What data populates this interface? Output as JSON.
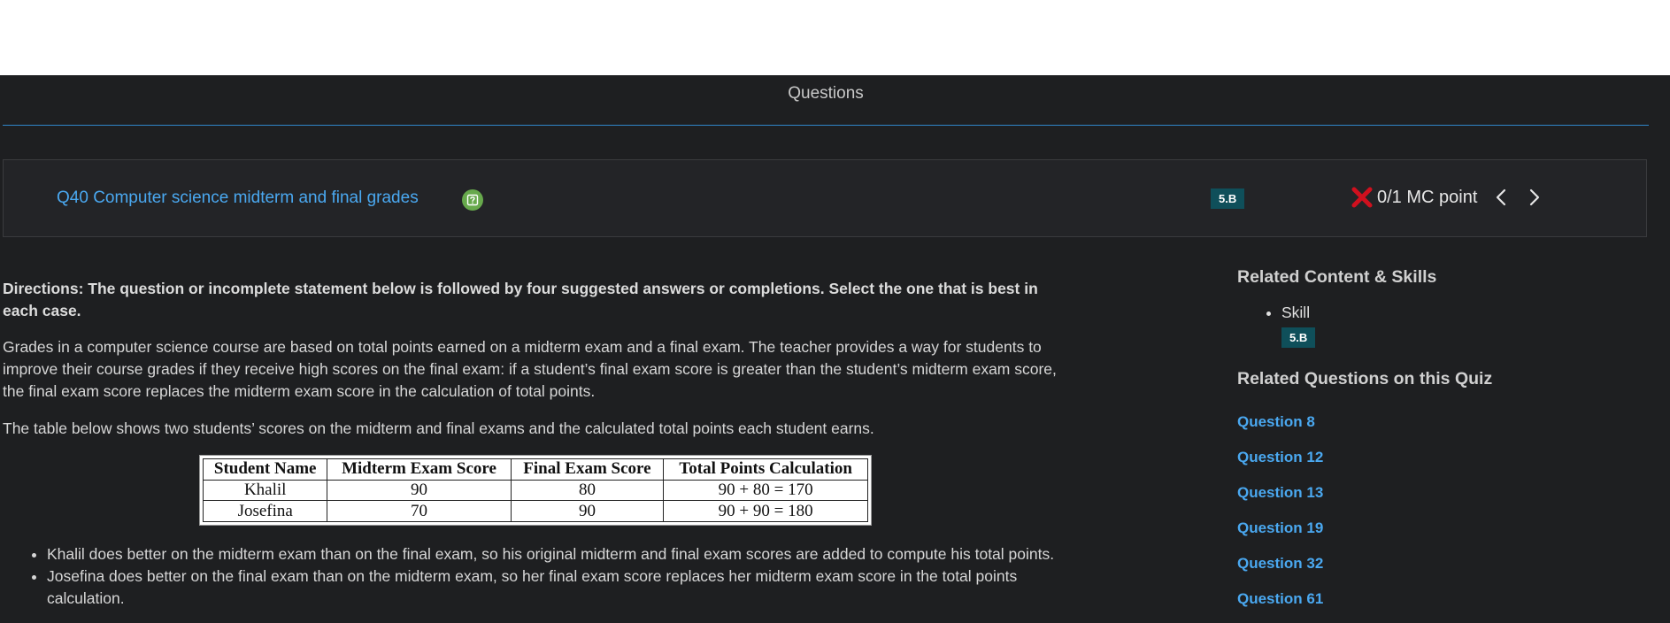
{
  "page": {
    "section_title": "Questions"
  },
  "question": {
    "title": "Q40 Computer science midterm and final grades",
    "skill_badge": "5.B",
    "score_text": "0/1 MC point",
    "result_icon": "red-x-icon",
    "help_icon": "question-mark-icon",
    "directions": "Directions: The question or incomplete statement below is followed by four suggested answers or completions. Select the one that is best in each case.",
    "prompt_p1": "Grades in a computer science course are based on total points earned on a midterm exam and a final exam. The teacher provides a way for students to improve their course grades if they receive high scores on the final exam: if a student’s final exam score is greater than the student’s midterm exam score, the final exam score replaces the midterm exam score in the calculation of total points.",
    "prompt_p2": "The table below shows two students’ scores on the midterm and final exams and the calculated total points each student earns.",
    "table": {
      "headers": [
        "Student Name",
        "Midterm Exam Score",
        "Final Exam Score",
        "Total Points Calculation"
      ],
      "rows": [
        [
          "Khalil",
          "90",
          "80",
          "90 + 80 = 170"
        ],
        [
          "Josefina",
          "70",
          "90",
          "90 + 90 = 180"
        ]
      ]
    },
    "bullets": [
      "Khalil does better on the midterm exam than on the final exam, so his original midterm and final exam scores are added to compute his total points.",
      "Josefina does better on the final exam than on the midterm exam, so her final exam score replaces her midterm exam score in the total points calculation."
    ]
  },
  "sidebar": {
    "related_heading": "Related Content & Skills",
    "skill_label": "Skill",
    "skill_badge": "5.B",
    "related_questions_heading": "Related Questions on this Quiz",
    "related_questions": [
      "Question 8",
      "Question 12",
      "Question 13",
      "Question 19",
      "Question 32",
      "Question 61"
    ]
  },
  "colors": {
    "link": "#4aa8f0",
    "badge_bg": "#0f4f5a",
    "incorrect": "#d0101e",
    "help_green": "#67a94c",
    "divider": "#2f86c9",
    "background": "#1e1f21"
  }
}
